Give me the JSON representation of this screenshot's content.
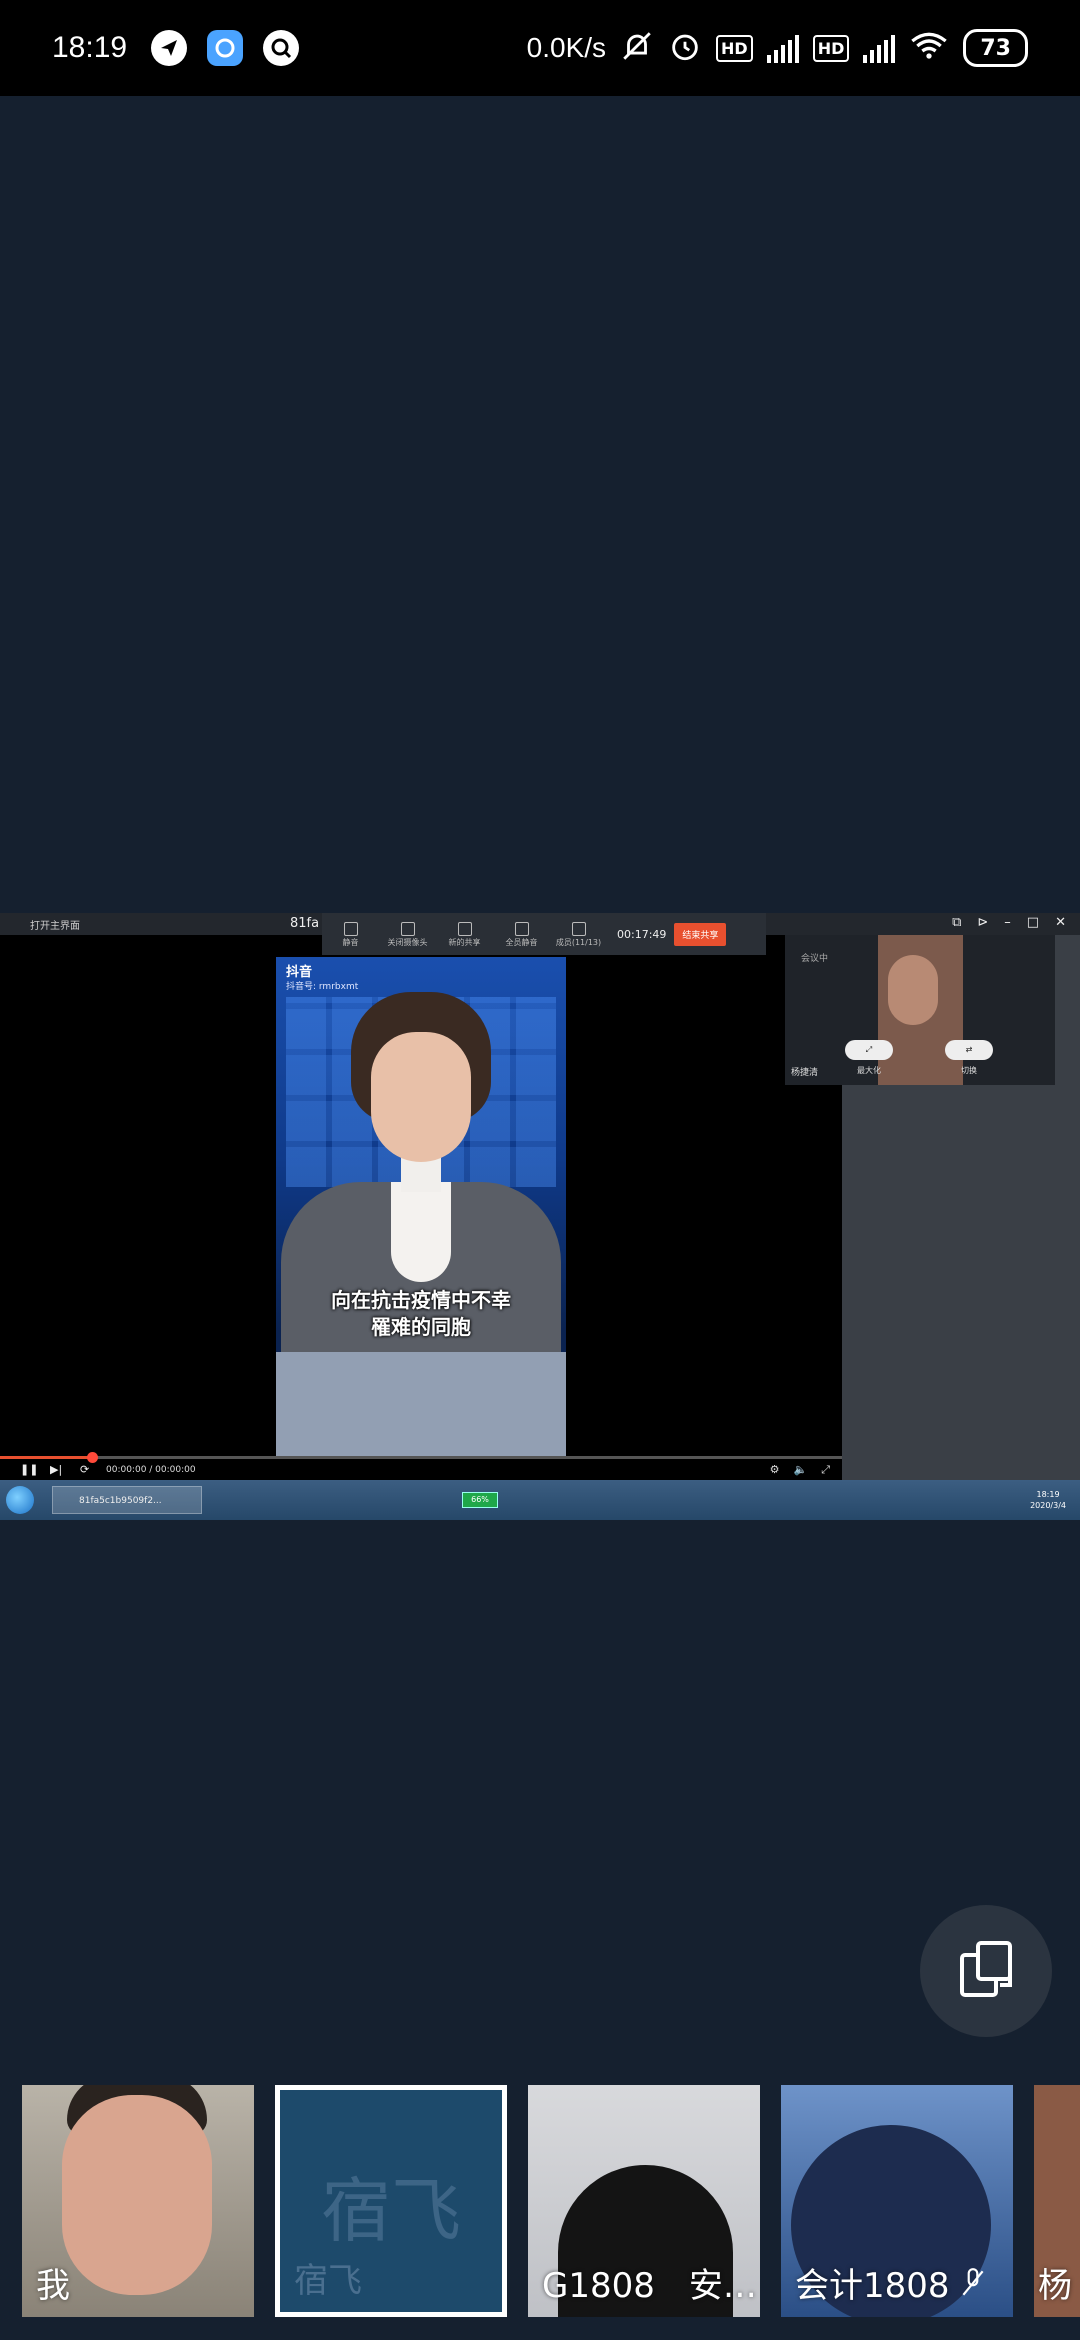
{
  "status_bar": {
    "time": "18:19",
    "net_speed": "0.0K/s",
    "hd1": "HD",
    "hd2": "HD",
    "net_type": "4G",
    "battery": "73",
    "icons": [
      "app-notification-icon",
      "app-browser-icon",
      "app-search-icon",
      "mute-bell-icon",
      "alarm-icon",
      "signal-icon",
      "wifi-icon",
      "battery-icon"
    ]
  },
  "shared_screen": {
    "open_main": "打开主界面",
    "meeting_id": "81fa",
    "toolbar": {
      "mute": "静音",
      "camera": "关闭摄像头",
      "share": "新的共享",
      "mute_all": "全员静音",
      "members": "成员(11/13)",
      "duration": "00:17:49",
      "end_share": "结束共享"
    },
    "video": {
      "app_name": "抖音",
      "douyin_id": "抖音号: rmrbxmt",
      "caption_line1": "向在抗击疫情中不幸",
      "caption_line2": "罹难的同胞"
    },
    "player_time": "00:00:00 / 00:00:00",
    "pip": {
      "status": "会议中",
      "user": "杨捷清",
      "maximize": "最大化",
      "switch": "切换"
    },
    "taskbar": {
      "task_item": "81fa5c1b9509f2...",
      "battery": "66%",
      "clock_time": "18:19",
      "clock_date": "2020/3/4"
    }
  },
  "participants": [
    {
      "name": "我",
      "big": ""
    },
    {
      "name": "宿飞",
      "big": "宿飞"
    },
    {
      "name": "G1808　安…",
      "big": ""
    },
    {
      "name": "会计1808",
      "big": ""
    },
    {
      "name": "杨",
      "big": ""
    }
  ],
  "colors": {
    "background": "#15202f",
    "end_share": "#e8502f",
    "selected_tile_border": "#ffffff"
  }
}
